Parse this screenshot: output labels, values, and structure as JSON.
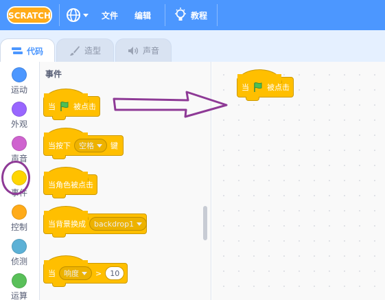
{
  "menubar": {
    "logo_text": "SCRATCH",
    "file_label": "文件",
    "edit_label": "编辑",
    "tutorials_label": "教程"
  },
  "tabs": [
    {
      "label": "代码",
      "icon": "code-icon",
      "active": true
    },
    {
      "label": "造型",
      "icon": "brush-icon",
      "active": false
    },
    {
      "label": "声音",
      "icon": "speaker-icon",
      "active": false
    }
  ],
  "categories": [
    {
      "label": "运动",
      "color": "#4c97ff"
    },
    {
      "label": "外观",
      "color": "#9966ff"
    },
    {
      "label": "声音",
      "color": "#cf63cf"
    },
    {
      "label": "事件",
      "color": "#ffd500",
      "selected": true
    },
    {
      "label": "控制",
      "color": "#ffab19"
    },
    {
      "label": "侦测",
      "color": "#5cb1d6"
    },
    {
      "label": "运算",
      "color": "#59c059"
    }
  ],
  "palette": {
    "title": "事件",
    "blocks": {
      "flag_clicked": {
        "when": "当",
        "clicked": "被点击"
      },
      "key_pressed": {
        "prefix": "当按下",
        "key": "空格",
        "suffix": "键"
      },
      "sprite_clicked": {
        "label": "当角色被点击"
      },
      "backdrop_switch": {
        "prefix": "当背景换成",
        "backdrop": "backdrop1"
      },
      "greater_than": {
        "prefix": "当",
        "sensor": "响度",
        "operator": ">",
        "value": "10"
      }
    }
  },
  "script_area": {
    "flag_clicked": {
      "when": "当",
      "clicked": "被点击"
    }
  },
  "colors": {
    "menubar": "#4c97ff",
    "events": "#ffbf00",
    "events_border": "#cc9900",
    "annotation": "#8e3a96",
    "flag": "#4cbf56"
  }
}
